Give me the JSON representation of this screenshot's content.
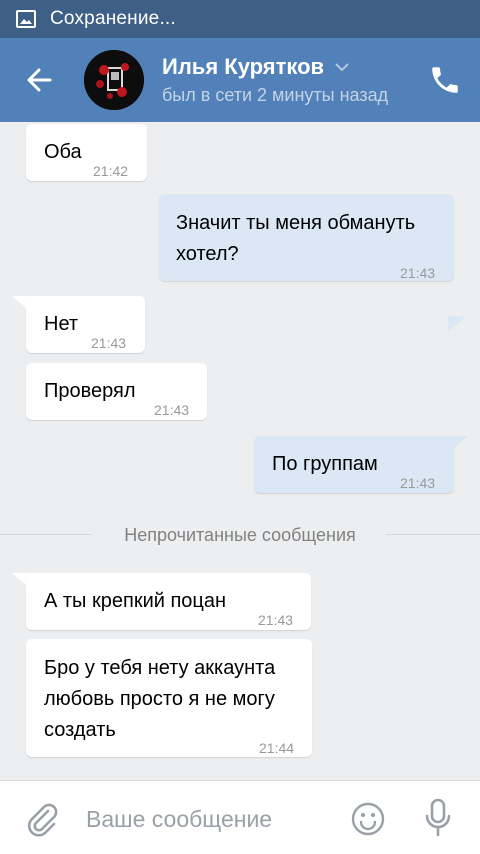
{
  "status_bar": {
    "notification_text": "Сохранение...",
    "notification_icon": "image-icon"
  },
  "header": {
    "contact_name": "Илья Курятков",
    "contact_status": "был в сети 2 минуты назад",
    "colors": {
      "header_bg": "#5181b8",
      "statusbar_bg": "#3e5f86"
    }
  },
  "messages": [
    {
      "direction": "in",
      "text": "Оба",
      "time": "21:42"
    },
    {
      "direction": "out",
      "lines": [
        "Значит ты меня обмануть",
        "хотел?"
      ],
      "time": "21:43"
    },
    {
      "direction": "in",
      "text": "Нет",
      "time": "21:43"
    },
    {
      "direction": "in",
      "text": "Проверял",
      "time": "21:43"
    },
    {
      "direction": "out",
      "text": "По группам",
      "time": "21:43"
    },
    {
      "direction": "in",
      "text": "А ты крепкий поцан",
      "time": "21:43"
    },
    {
      "direction": "in",
      "lines": [
        "Бро у тебя нету аккаунта",
        "любовь просто я не могу",
        "создать"
      ],
      "time": "21:44"
    }
  ],
  "unread_divider": "Непрочитанные сообщения",
  "composer": {
    "placeholder": "Ваше сообщение"
  },
  "colors": {
    "incoming_bubble": "#ffffff",
    "outgoing_bubble": "#dbe7f5",
    "background": "#edeef0"
  }
}
